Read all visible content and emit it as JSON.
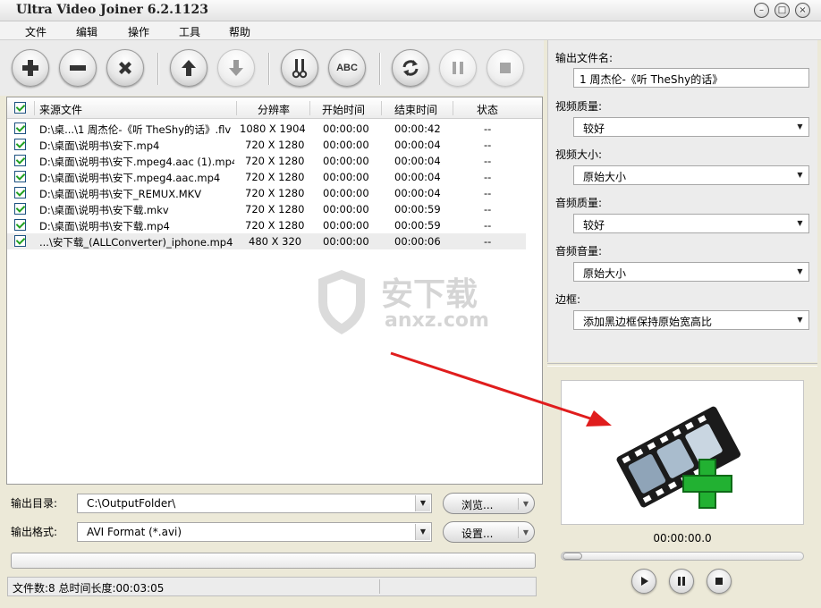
{
  "window": {
    "title": "Ultra Video Joiner 6.2.1123",
    "controls": [
      "minimize",
      "maximize",
      "close"
    ]
  },
  "menu": [
    "文件",
    "编辑",
    "操作",
    "工具",
    "帮助"
  ],
  "toolbar": {
    "buttons": [
      {
        "name": "add-button",
        "icon": "plus-icon",
        "label": "",
        "enabled": true
      },
      {
        "name": "remove-button",
        "icon": "minus-icon",
        "label": "",
        "enabled": true
      },
      {
        "name": "clear-button",
        "icon": "x-icon",
        "label": "",
        "enabled": true
      },
      {
        "name": "move-up-button",
        "icon": "arrow-up-icon",
        "label": "",
        "enabled": true
      },
      {
        "name": "move-down-button",
        "icon": "arrow-down-icon",
        "label": "",
        "enabled": false
      },
      {
        "name": "cut-button",
        "icon": "scissors-icon",
        "label": "",
        "enabled": true
      },
      {
        "name": "rename-button",
        "icon": "abc-icon",
        "label": "ABC",
        "enabled": true
      },
      {
        "name": "convert-button",
        "icon": "refresh-icon",
        "label": "",
        "enabled": true
      },
      {
        "name": "pause-button",
        "icon": "pause-icon",
        "label": "",
        "enabled": false
      },
      {
        "name": "stop-button",
        "icon": "stop-icon",
        "label": "",
        "enabled": false
      }
    ]
  },
  "file_table": {
    "columns": [
      "来源文件",
      "分辨率",
      "开始时间",
      "结束时间",
      "状态"
    ],
    "rows": [
      {
        "checked": true,
        "file": "D:\\桌...\\1 周杰伦-《听 TheShy的话》.flv",
        "resolution": "1080 X 1904",
        "start": "00:00:00",
        "end": "00:00:42",
        "status": "--"
      },
      {
        "checked": true,
        "file": "D:\\桌面\\说明书\\安下.mp4",
        "resolution": "720 X 1280",
        "start": "00:00:00",
        "end": "00:00:04",
        "status": "--"
      },
      {
        "checked": true,
        "file": "D:\\桌面\\说明书\\安下.mpeg4.aac (1).mp4",
        "resolution": "720 X 1280",
        "start": "00:00:00",
        "end": "00:00:04",
        "status": "--"
      },
      {
        "checked": true,
        "file": "D:\\桌面\\说明书\\安下.mpeg4.aac.mp4",
        "resolution": "720 X 1280",
        "start": "00:00:00",
        "end": "00:00:04",
        "status": "--"
      },
      {
        "checked": true,
        "file": "D:\\桌面\\说明书\\安下_REMUX.MKV",
        "resolution": "720 X 1280",
        "start": "00:00:00",
        "end": "00:00:04",
        "status": "--"
      },
      {
        "checked": true,
        "file": "D:\\桌面\\说明书\\安下载.mkv",
        "resolution": "720 X 1280",
        "start": "00:00:00",
        "end": "00:00:59",
        "status": "--"
      },
      {
        "checked": true,
        "file": "D:\\桌面\\说明书\\安下载.mp4",
        "resolution": "720 X 1280",
        "start": "00:00:00",
        "end": "00:00:59",
        "status": "--"
      },
      {
        "checked": true,
        "file": "...\\安下载_(ALLConverter)_iphone.mp4",
        "resolution": "480 X 320",
        "start": "00:00:00",
        "end": "00:00:06",
        "status": "--",
        "selected": true
      }
    ]
  },
  "watermark": {
    "text_cn": "安下载",
    "text_en": "anxz.com"
  },
  "output": {
    "dir_label": "输出目录:",
    "dir_value": "C:\\OutputFolder\\",
    "browse_label": "浏览...",
    "format_label": "输出格式:",
    "format_value": "AVI Format (*.avi)",
    "settings_label": "设置..."
  },
  "status": {
    "text": "文件数:8  总时间长度:00:03:05"
  },
  "settings": {
    "filename_label": "输出文件名:",
    "filename_value": "1 周杰伦-《听 TheShy的话》",
    "video_quality_label": "视频质量:",
    "video_quality_value": "较好",
    "video_size_label": "视频大小:",
    "video_size_value": "原始大小",
    "audio_quality_label": "音频质量:",
    "audio_quality_value": "较好",
    "audio_volume_label": "音频音量:",
    "audio_volume_value": "原始大小",
    "border_label": "边框:",
    "border_value": "添加黑边框保持原始宽高比"
  },
  "preview": {
    "timecode": "00:00:00.0",
    "seek_position": 0
  },
  "colors": {
    "arrow": "#e01d1d",
    "plus_green": "#22b132",
    "check_green": "#21a121"
  }
}
